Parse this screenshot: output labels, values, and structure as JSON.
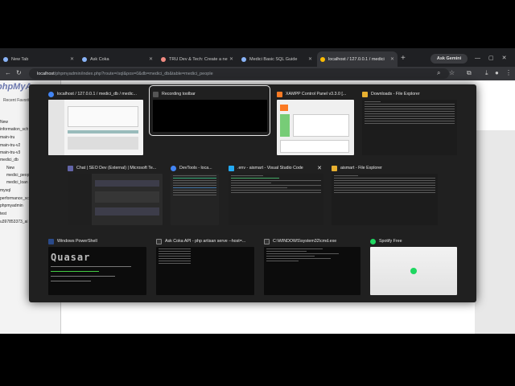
{
  "browser": {
    "tabs": [
      {
        "label": "New Tab",
        "color": "#8ab4f8"
      },
      {
        "label": "Ask Coka",
        "color": "#8ab4f8"
      },
      {
        "label": "TRU Dev & Tech: Create a ne",
        "color": "#f28b82"
      },
      {
        "label": "Medici Basic SQL Guide",
        "color": "#8ab4f8"
      },
      {
        "label": "localhost / 127.0.0.1 / medici",
        "color": "#fbbc04"
      }
    ],
    "new_tab_glyph": "+",
    "ask_gemini": "Ask Gemini",
    "url_host": "localhost",
    "url_path": "/phpmyadmin/index.php?route=/sql&pos=0&db=medici_db&table=medici_people"
  },
  "pma": {
    "logo": "phpMyA",
    "tabs": "Recent   Favorites",
    "tree": [
      "New",
      "information_sch",
      "main-tru",
      "main-tru-v2",
      "main-tru-v3",
      "medici_db",
      "New",
      "medici_peop",
      "medici_loan",
      "mysql",
      "performance_sc",
      "phpmyadmin",
      "test",
      "u397853373_ai"
    ]
  },
  "switcher": {
    "windows": [
      {
        "title": "localhost / 127.0.0.1 / medici_db / medic...",
        "icon": "chrome-icon"
      },
      {
        "title": "Recording toolbar",
        "icon": "recording-icon"
      },
      {
        "title": "XAMPP Control Panel v3.3.0   [...",
        "icon": "xampp-icon"
      },
      {
        "title": "Downloads - File Explorer",
        "icon": "folder-icon"
      },
      {
        "title": "Chat | SEO Dev (External) | Microsoft Te...",
        "icon": "teams-icon"
      },
      {
        "title": "DevTools - loca...",
        "icon": "devtools-icon"
      },
      {
        "title": ".env - aismart - Visual Studio Code",
        "icon": "vscode-icon"
      },
      {
        "title": "aismart - File Explorer",
        "icon": "folder-icon"
      },
      {
        "title": "Windows PowerShell",
        "icon": "powershell-icon"
      },
      {
        "title": "Ask Coka API - php  artisan serve --host=...",
        "icon": "terminal-icon"
      },
      {
        "title": "C:\\WINDOWS\\system32\\cmd.exe",
        "icon": "cmd-icon"
      },
      {
        "title": "Spotify Free",
        "icon": "spotify-icon"
      }
    ],
    "close_glyph": "✕",
    "quasar_text": "Quasar"
  }
}
